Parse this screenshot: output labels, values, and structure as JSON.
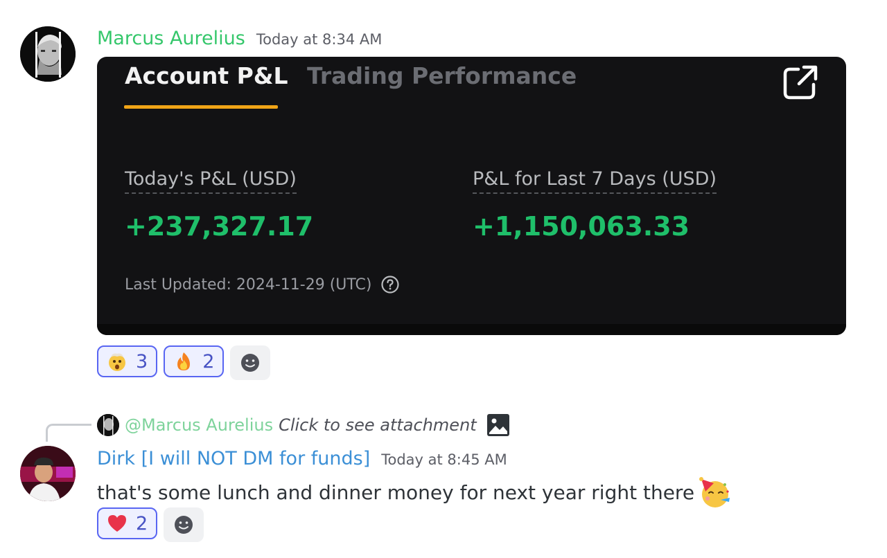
{
  "messages": [
    {
      "author": "Marcus Aurelius",
      "timestamp": "Today at 8:34 AM",
      "author_color": "#35c76b",
      "embed": {
        "tabs": [
          "Account P&L",
          "Trading Performance"
        ],
        "active_tab": "Account P&L",
        "accent_color": "#f0a417",
        "stats": [
          {
            "label": "Today's P&L (USD)",
            "value": "+237,327.17"
          },
          {
            "label": "P&L for Last 7 Days (USD)",
            "value": "+1,150,063.33"
          }
        ],
        "last_updated": "Last Updated: 2024-11-29 (UTC)",
        "value_color": "#1fbf6a"
      },
      "reactions": [
        {
          "emoji": "exploding-head-icon",
          "count": "3"
        },
        {
          "emoji": "fire-icon",
          "count": "2"
        }
      ]
    },
    {
      "reply_to": {
        "mention": "@Marcus Aurelius",
        "text": "Click to see attachment"
      },
      "author": "Dirk [I will NOT DM for funds]",
      "timestamp": "Today at 8:45 AM",
      "author_color": "#3b8fd6",
      "text": "that's some lunch and dinner money for next year right there",
      "reactions": [
        {
          "emoji": "red-heart-icon",
          "count": "2"
        }
      ]
    }
  ]
}
